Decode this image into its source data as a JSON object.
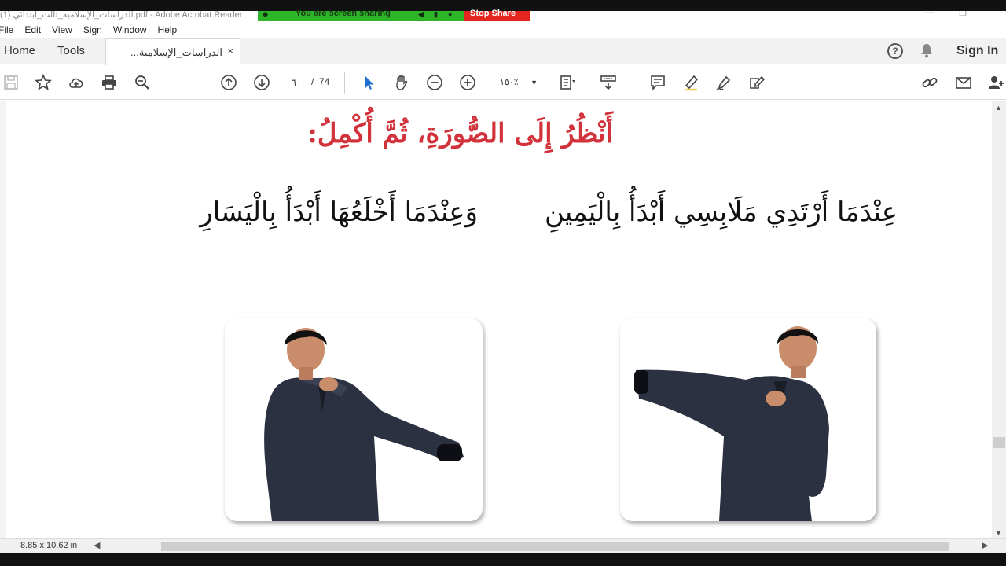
{
  "window": {
    "title": "الدراسات_الإسلامية_ثالث_ابتدائي (1).pdf - Adobe Acrobat Reader",
    "minimize": "—",
    "maximize": "❐"
  },
  "screen_share": {
    "status": "You are screen sharing",
    "stop": "Stop Share",
    "colors": {
      "green": "#2fb52a",
      "red": "#e2251e"
    }
  },
  "menu": [
    "File",
    "Edit",
    "View",
    "Sign",
    "Window",
    "Help"
  ],
  "tabs": {
    "home": "Home",
    "tools": "Tools",
    "document": "الدراسات_الإسلامية...",
    "close": "×"
  },
  "header_right": {
    "help": "?",
    "sign_in": "Sign In"
  },
  "toolbar": {
    "current_page": "٦٠",
    "page_separator": "/",
    "total_pages": "74",
    "zoom": "١٥٠٪",
    "zoom_caret": "▼",
    "icons": [
      "save-icon",
      "bookmark-star-icon",
      "upload-cloud-icon",
      "print-icon",
      "zoom-search-icon",
      "prev-page-icon",
      "next-page-icon",
      "select-cursor-icon",
      "hand-pan-icon",
      "zoom-out-icon",
      "zoom-in-icon",
      "fit-page-icon",
      "scroll-mode-icon",
      "comment-icon",
      "highlight-pen-icon",
      "draw-sign-icon",
      "fill-sign-icon",
      "link-share-icon",
      "email-icon",
      "add-user-icon"
    ]
  },
  "document": {
    "heading": "أَنْظُرُ إِلَى الصُّورَةِ، ثُمَّ أُكْمِلُ:",
    "line_right": "عِنْدَمَا أَرْتَدِي مَلَابِسِي أَبْدَأُ بِالْيَمِينِ",
    "line_left": "وَعِنْدَمَا أَخْلَعُهَا أَبْدَأُ بِالْيَسَارِ",
    "images": [
      "boy-removing-thobe-photo",
      "boy-wearing-thobe-photo"
    ]
  },
  "statusbar": {
    "page_size": "8.85 x 10.62 in",
    "left_arrow": "◀",
    "right_arrow": "▶"
  },
  "scrollbar": {
    "up": "▲",
    "down": "▼"
  }
}
